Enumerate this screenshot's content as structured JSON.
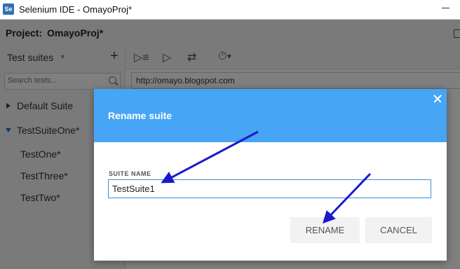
{
  "window": {
    "title": "Selenium IDE - OmayoProj*",
    "icon_text": "Se"
  },
  "project": {
    "label": "Project:",
    "name": "OmayoProj*"
  },
  "sidebar": {
    "suite_select": "Test suites",
    "add_label": "+",
    "search_placeholder": "Search tests...",
    "suites": [
      {
        "label": "Default Suite"
      },
      {
        "label": "TestSuiteOne*"
      }
    ],
    "tests": [
      {
        "label": "TestOne*"
      },
      {
        "label": "TestThree*"
      },
      {
        "label": "TestTwo*"
      }
    ]
  },
  "toolbar": {
    "icons": [
      "run-all-icon",
      "run-icon",
      "step-icon",
      "speed-icon"
    ]
  },
  "url": {
    "value": "http://omayo.blogspot.com"
  },
  "dialog": {
    "title": "Rename suite",
    "field_label": "SUITE NAME",
    "field_value": "TestSuite1",
    "rename_label": "RENAME",
    "cancel_label": "CANCEL"
  },
  "colors": {
    "dialog_header": "#47a5f5",
    "input_border": "#3b8fd8",
    "annotation_arrow": "#1a1acc"
  }
}
